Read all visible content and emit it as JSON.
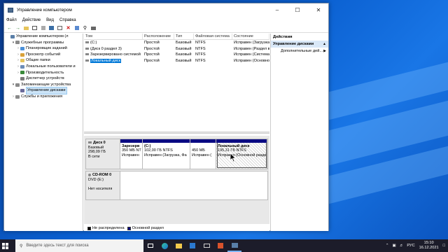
{
  "window": {
    "title": "Управление компьютером"
  },
  "menu": [
    "Файл",
    "Действие",
    "Вид",
    "Справка"
  ],
  "tree": [
    {
      "label": "Управление компьютером (л",
      "indent": 0,
      "arrow": "",
      "icon": "#5a7fa8"
    },
    {
      "label": "Служебные программы",
      "indent": 1,
      "arrow": "▾",
      "icon": "#8a8a8a"
    },
    {
      "label": "Планировщик заданий",
      "indent": 2,
      "arrow": "›",
      "icon": "#4a90d9"
    },
    {
      "label": "Просмотр событий",
      "indent": 2,
      "arrow": "›",
      "icon": "#d9a23a"
    },
    {
      "label": "Общие папки",
      "indent": 2,
      "arrow": "›",
      "icon": "#e6c45a"
    },
    {
      "label": "Локальные пользователи и",
      "indent": 2,
      "arrow": "›",
      "icon": "#6b8cb8"
    },
    {
      "label": "Производительность",
      "indent": 2,
      "arrow": "›",
      "icon": "#3a8a3a"
    },
    {
      "label": "Диспетчер устройств",
      "indent": 2,
      "arrow": "",
      "icon": "#7a7a7a"
    },
    {
      "label": "Запоминающие устройства",
      "indent": 1,
      "arrow": "▾",
      "icon": "#8a8a8a"
    },
    {
      "label": "Управление дисками",
      "indent": 2,
      "arrow": "",
      "icon": "#6a6a9a",
      "selected": true
    },
    {
      "label": "Службы и приложения",
      "indent": 1,
      "arrow": "›",
      "icon": "#8a8a8a"
    }
  ],
  "volumes": {
    "headers": [
      "Том",
      "Расположение",
      "Тип",
      "Файловая система",
      "Состояние"
    ],
    "rows": [
      [
        "(C:)",
        "Простой",
        "Базовый",
        "NTFS",
        "Исправен (Загрузка,"
      ],
      [
        "(Диск 0 раздел 3)",
        "Простой",
        "Базовый",
        "NTFS",
        "Исправен (Раздел в"
      ],
      [
        "Зарезервировано системой",
        "Простой",
        "Базовый",
        "NTFS",
        "Исправен (Система,"
      ],
      [
        "Локальный диск",
        "Простой",
        "Базовый",
        "NTFS",
        "Исправен (Основной"
      ]
    ],
    "selected_row": 3
  },
  "disks": [
    {
      "name": "Диск 0",
      "lines": [
        "Базовый",
        "298,09 ГБ",
        "В сети"
      ],
      "partitions": [
        {
          "name": "Зарезерв",
          "size": "350 МБ NT",
          "status": "Исправен"
        },
        {
          "name": "(C:)",
          "size": "102,00 ГБ NTFS",
          "status": "Исправен (Загрузка, Фа"
        },
        {
          "name": "",
          "size": "450 МБ",
          "status": "Исправен ("
        },
        {
          "name": "Локальный диск",
          "size": "195,31 ГБ NTFS",
          "status": "Исправен (Основной раздел)"
        }
      ]
    },
    {
      "name": "CD-ROM 0",
      "lines": [
        "DVD (E:)",
        "",
        "Нет носителя"
      ]
    }
  ],
  "legend": [
    "Не распределена",
    "Основной раздел"
  ],
  "actions": {
    "header": "Действия",
    "section": "Управление дисками",
    "item": "Дополнительные дей..."
  },
  "taskbar": {
    "search_placeholder": "Введите здесь текст для поиска",
    "lang": "РУС",
    "time": "15:10",
    "date": "16.12.2021"
  },
  "colors": {
    "primary_partition": "#0a0a82",
    "selection": "#0078d7",
    "desktop": "#0a5fd0"
  }
}
